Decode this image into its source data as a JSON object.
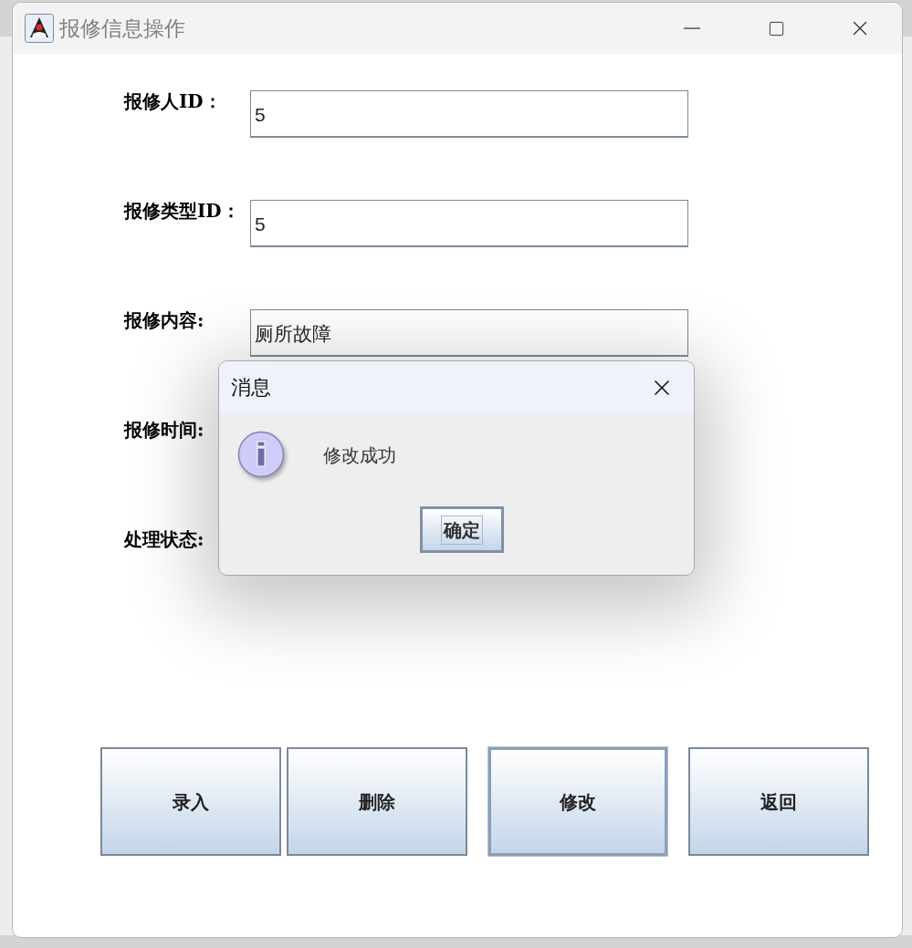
{
  "window": {
    "title": "报修信息操作"
  },
  "form": [
    {
      "label": "报修人ID：",
      "value": "5"
    },
    {
      "label": "报修类型ID：",
      "value": "5"
    },
    {
      "label": "报修内容:",
      "value": "厕所故障"
    },
    {
      "label": "报修时间:"
    },
    {
      "label": "处理状态:"
    }
  ],
  "buttons": [
    {
      "label": "录入",
      "focused": false
    },
    {
      "label": "删除",
      "focused": false
    },
    {
      "label": "修改",
      "focused": true
    },
    {
      "label": "返回",
      "focused": false
    }
  ],
  "dialog": {
    "title": "消息",
    "message": "修改成功",
    "button": "确定"
  }
}
